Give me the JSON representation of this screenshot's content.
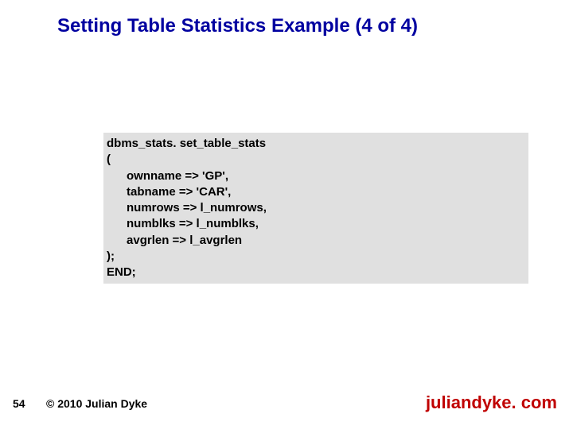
{
  "title": "Setting Table Statistics Example (4 of 4)",
  "code": "dbms_stats. set_table_stats\n(\n      ownname => 'GP',\n      tabname => 'CAR',\n      numrows => l_numrows,\n      numblks => l_numblks,\n      avgrlen => l_avgrlen\n);\nEND;",
  "footer": {
    "page": "54",
    "copyright": "© 2010 Julian Dyke",
    "site": "juliandyke. com"
  }
}
